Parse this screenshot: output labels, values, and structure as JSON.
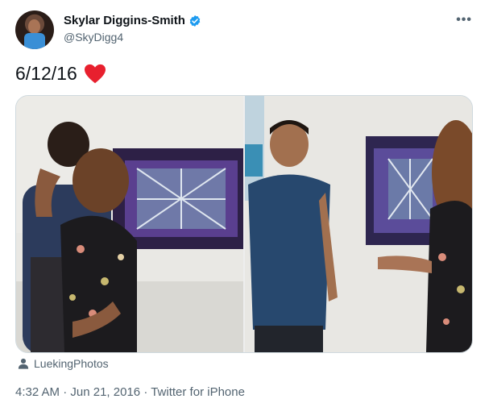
{
  "author": {
    "display_name": "Skylar Diggins-Smith",
    "handle": "@SkyDigg4",
    "avatar_icon": "avatar",
    "verified_icon": "verified-badge-icon",
    "verified_color": "#1d9bf0"
  },
  "tweet": {
    "text": "6/12/16",
    "emoji_icon": "red-heart-icon",
    "emoji_color": "#e8202e"
  },
  "menu": {
    "more_label": "•••"
  },
  "media": {
    "photos": [
      {
        "name": "photo-hug"
      },
      {
        "name": "photo-smiling"
      }
    ]
  },
  "credit": {
    "icon": "person-icon",
    "text": "LuekingPhotos"
  },
  "meta": {
    "time": "4:32 AM",
    "separator": "·",
    "date": "Jun 21, 2016",
    "source": "Twitter for iPhone"
  }
}
